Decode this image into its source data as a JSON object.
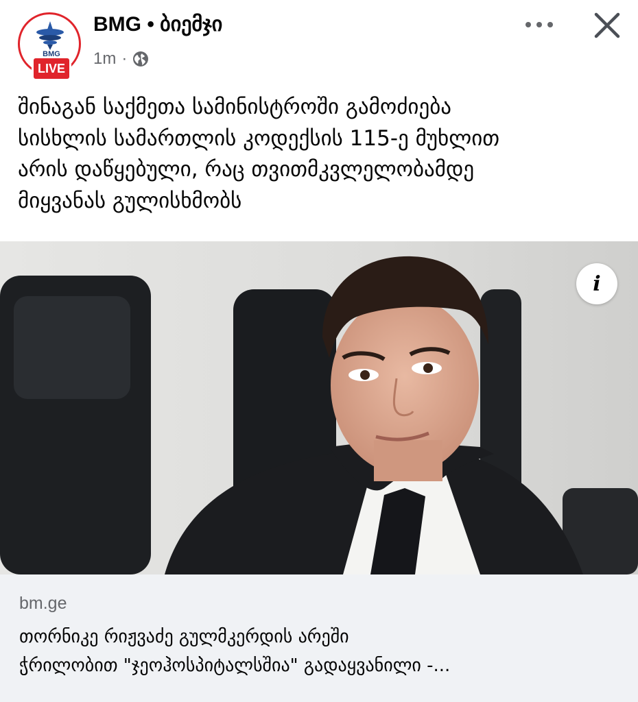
{
  "post": {
    "page_name": "BMG • ბიემჯი",
    "avatar_brand": "BMG",
    "live_badge": "LIVE",
    "timestamp": "1m",
    "separator": "·",
    "audience_icon": "globe-icon",
    "text_lines": [
      "შინაგან საქმეთა სამინისტროში გამოძიება",
      "სისხლის სამართლის კოდექსის 115-ე მუხლით",
      "არის დაწყებული, რაც თვითმკვლელობამდე",
      "მიყვანას გულისხმობს"
    ],
    "info_label": "i"
  },
  "link_preview": {
    "domain": "bm.ge",
    "title_lines": [
      "თორნიკე რიჟვაძე გულმკერდის არეში",
      "ჭრილობით \"ჯეოჰოსპიტალსშია\" გადაყვანილი -..."
    ]
  },
  "colors": {
    "accent_red": "#e0242b",
    "text_primary": "#050505",
    "text_secondary": "#65676b",
    "preview_bg": "#f0f2f5"
  }
}
